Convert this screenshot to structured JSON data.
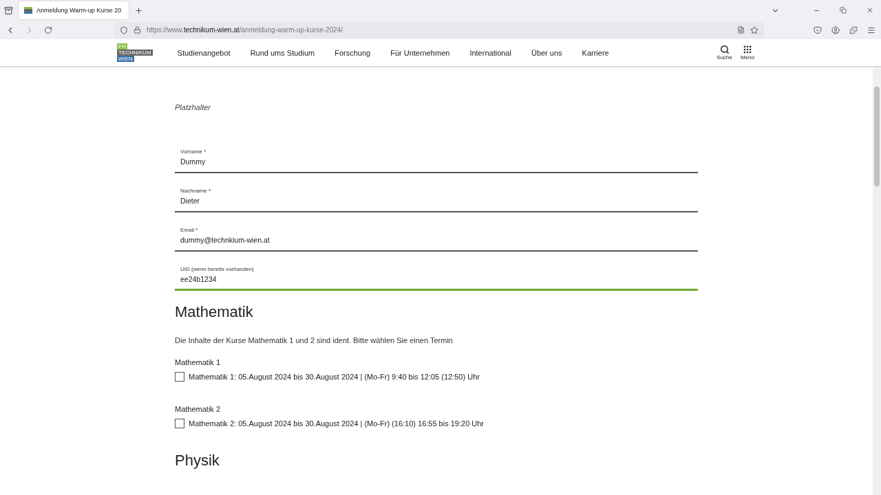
{
  "browser": {
    "tab": {
      "title": "Anmeldung Warm-up Kurse 20",
      "selected": true
    },
    "url": {
      "prefix": "https://www.",
      "domain": "technikum-wien.at",
      "path": "/anmeldung-warm-up-kurse-2024/"
    }
  },
  "site_header": {
    "logo": [
      "FH",
      "TECHNIKUM",
      "WIEN"
    ],
    "nav": [
      "Studienangebot",
      "Rund ums Studium",
      "Forschung",
      "Für Unternehmen",
      "International",
      "Über uns",
      "Karriere"
    ],
    "actions": [
      {
        "kind": "search",
        "label": "Suche"
      },
      {
        "kind": "menu",
        "label": "Menü"
      }
    ]
  },
  "form": {
    "intro": "Platzhalter",
    "fields": [
      {
        "label": "Vorname *",
        "value": "Dummy",
        "focused": false
      },
      {
        "label": "Nachname *",
        "value": "Dieter",
        "focused": false
      },
      {
        "label": "Email *",
        "value": "dummy@technkium-wien.at",
        "focused": false
      },
      {
        "label": "UID (wenn bereits vorhanden)",
        "value": "ee24b1234",
        "focused": true
      }
    ],
    "sections": [
      {
        "title": "Mathematik",
        "text": "Die Inhalte der Kurse Mathematik 1 und 2 sind ident. Bitte wählen Sie einen Termin",
        "courses": [
          {
            "name": "Mathematik 1",
            "option": "Mathematik 1: 05.August 2024 bis 30.August 2024 | (Mo-Fr) 9:40 bis 12:05 (12:50) Uhr",
            "checked": false
          },
          {
            "name": "Mathematik 2",
            "option": "Mathematik 2: 05.August 2024 bis 30.August 2024 | (Mo-Fr) (16:10) 16:55 bis 19:20 Uhr",
            "checked": false
          }
        ]
      },
      {
        "title": "Physik"
      }
    ]
  }
}
